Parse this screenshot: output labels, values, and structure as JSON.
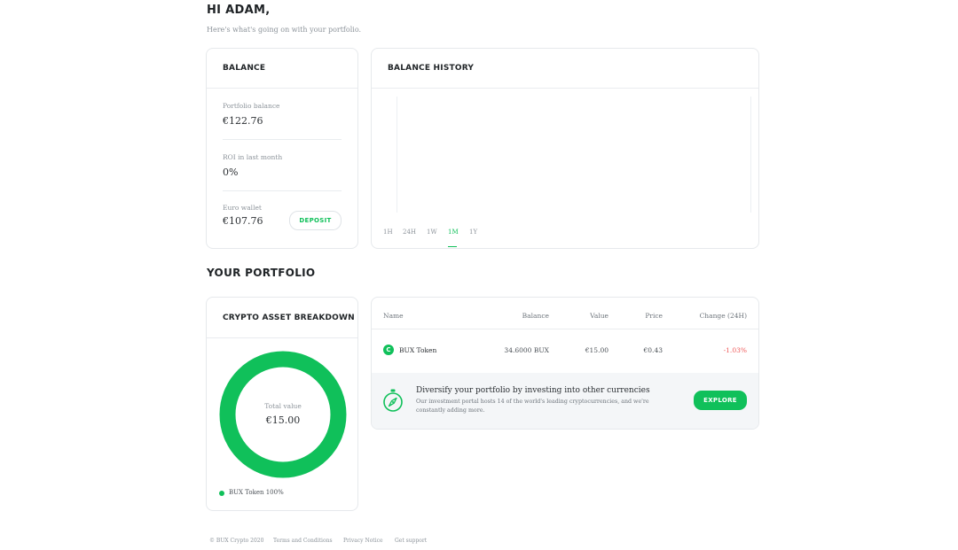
{
  "greeting": {
    "title": "HI ADAM,",
    "subtitle": "Here's what's going on with your portfolio."
  },
  "balance_card": {
    "title": "BALANCE",
    "portfolio_label": "Portfolio balance",
    "portfolio_value": "€122.76",
    "roi_label": "ROI in last month",
    "roi_value": "0%",
    "wallet_label": "Euro wallet",
    "wallet_value": "€107.76",
    "deposit_label": "DEPOSIT"
  },
  "history_card": {
    "title": "BALANCE HISTORY",
    "ranges": [
      "1H",
      "24H",
      "1W",
      "1M",
      "1Y"
    ],
    "active_range": "1M"
  },
  "portfolio": {
    "title": "YOUR PORTFOLIO",
    "breakdown_title": "CRYPTO ASSET BREAKDOWN",
    "total_label": "Total value",
    "total_value": "€15.00",
    "legend": "BUX Token 100%",
    "donut_share": 1.0,
    "table": {
      "headers": [
        "Name",
        "Balance",
        "Value",
        "Price",
        "Change (24H)"
      ],
      "rows": [
        {
          "name": "BUX Token",
          "icon_letter": "C",
          "balance": "34.6000 BUX",
          "value": "€15.00",
          "price": "€0.43",
          "change": "-1.03%"
        }
      ]
    },
    "promo": {
      "title": "Diversify your portfolio by investing into other currencies",
      "body_line1": "Our investment portal hosts 14 of the world's leading cryptocurrencies, and we're",
      "body_line2": "constantly adding more.",
      "button": "EXPLORE"
    }
  },
  "footer": {
    "copyright": "© BUX Crypto 2020",
    "links": [
      "Terms and Conditions",
      "Privacy Notice",
      "Get support"
    ]
  },
  "colors": {
    "accent": "#10c05a",
    "negative": "#ef5b5b"
  }
}
